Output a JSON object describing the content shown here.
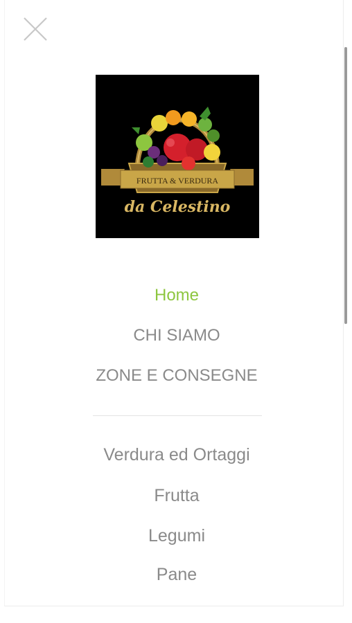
{
  "close_icon": "close-icon",
  "logo": {
    "line1": "FRUTTA & VERDURA",
    "line2": "da Celestino",
    "colors": {
      "background": "#000000",
      "gold": "#c9a648",
      "banner": "#b08a3a"
    }
  },
  "main_menu": [
    {
      "label": "Home",
      "active": true
    },
    {
      "label": "CHI SIAMO",
      "active": false
    },
    {
      "label": "ZONE E CONSEGNE",
      "active": false
    }
  ],
  "category_menu": [
    {
      "label": "Verdura ed Ortaggi"
    },
    {
      "label": "Frutta"
    },
    {
      "label": "Legumi"
    },
    {
      "label": "Pane"
    }
  ],
  "colors": {
    "active": "#8dc63f",
    "text": "#8a8a8a",
    "divider": "#e3e3e3"
  }
}
